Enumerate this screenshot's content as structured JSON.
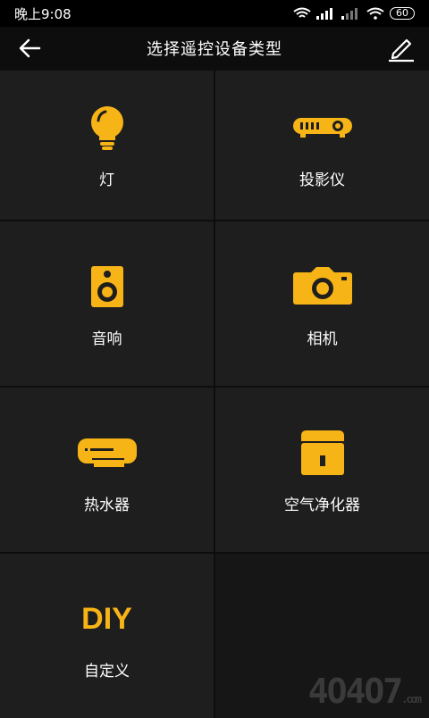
{
  "status": {
    "time": "晚上9:08",
    "battery": "60"
  },
  "header": {
    "title": "选择遥控设备类型"
  },
  "accent": "#f7b417",
  "devices": [
    {
      "label": "灯",
      "icon": "bulb-icon"
    },
    {
      "label": "投影仪",
      "icon": "projector-icon"
    },
    {
      "label": "音响",
      "icon": "speaker-icon"
    },
    {
      "label": "相机",
      "icon": "camera-icon"
    },
    {
      "label": "热水器",
      "icon": "water-heater-icon"
    },
    {
      "label": "空气净化器",
      "icon": "air-purifier-icon"
    },
    {
      "label": "自定义",
      "icon_text": "DIY"
    }
  ],
  "watermark": {
    "text": "4O4O7",
    "suffix": ".com"
  }
}
